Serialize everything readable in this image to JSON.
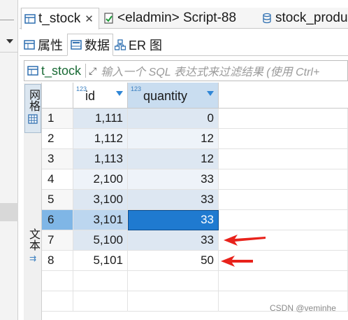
{
  "editor_tabs": [
    {
      "label": "t_stock",
      "icon": "table-icon",
      "active": true,
      "closable": true
    },
    {
      "label": "<eladmin> Script-88",
      "icon": "sql-script-icon",
      "active": false
    },
    {
      "label": "stock_produ",
      "icon": "database-table-icon",
      "active": false
    }
  ],
  "view_tabs": [
    {
      "label": "属性",
      "icon": "properties-icon"
    },
    {
      "label": "数据",
      "icon": "data-icon",
      "active": true
    },
    {
      "label": "ER 图",
      "icon": "er-diagram-icon"
    }
  ],
  "filter": {
    "table_name": "t_stock",
    "placeholder": "输入一个 SQL 表达式来过滤结果 (使用 Ctrl+"
  },
  "view_switch": {
    "grid_label": "网格",
    "text_label": "文本"
  },
  "columns": [
    {
      "type_badge": "123",
      "name": "id"
    },
    {
      "type_badge": "123",
      "name": "quantity"
    }
  ],
  "rows": [
    {
      "num": "1",
      "id": "1,111",
      "quantity": "0"
    },
    {
      "num": "2",
      "id": "1,112",
      "quantity": "12"
    },
    {
      "num": "3",
      "id": "1,113",
      "quantity": "12"
    },
    {
      "num": "4",
      "id": "2,100",
      "quantity": "33"
    },
    {
      "num": "5",
      "id": "3,100",
      "quantity": "33"
    },
    {
      "num": "6",
      "id": "3,101",
      "quantity": "33",
      "selected": true
    },
    {
      "num": "7",
      "id": "5,100",
      "quantity": "33"
    },
    {
      "num": "8",
      "id": "5,101",
      "quantity": "50"
    }
  ],
  "annotation_color": "#e8221b",
  "watermark": "CSDN @veminhe"
}
